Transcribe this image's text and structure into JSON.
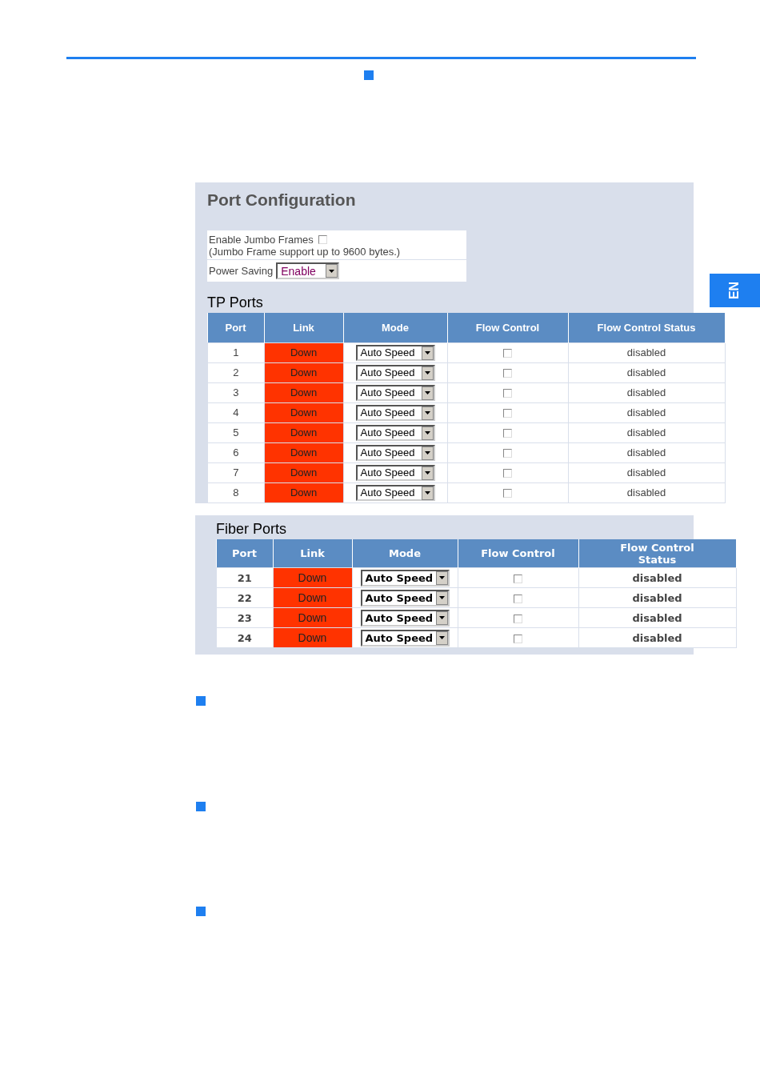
{
  "language_tab": "EN",
  "panel": {
    "title": "Port Configuration",
    "jumbo_frames": {
      "label": "Enable Jumbo Frames",
      "checked": false,
      "note": "(Jumbo Frame support up to 9600 bytes.)"
    },
    "power_saving": {
      "label": "Power Saving",
      "value": "Enable"
    }
  },
  "tp_ports": {
    "title": "TP Ports",
    "columns": [
      "Port",
      "Link",
      "Mode",
      "Flow Control",
      "Flow Control Status"
    ],
    "rows": [
      {
        "port": "1",
        "link": "Down",
        "link_up": false,
        "mode": "Auto Speed",
        "flow_control": false,
        "status": "disabled"
      },
      {
        "port": "2",
        "link": "Down",
        "link_up": false,
        "mode": "Auto Speed",
        "flow_control": false,
        "status": "disabled"
      },
      {
        "port": "3",
        "link": "Down",
        "link_up": false,
        "mode": "Auto Speed",
        "flow_control": false,
        "status": "disabled"
      },
      {
        "port": "4",
        "link": "Down",
        "link_up": false,
        "mode": "Auto Speed",
        "flow_control": false,
        "status": "disabled"
      },
      {
        "port": "5",
        "link": "Down",
        "link_up": false,
        "mode": "Auto Speed",
        "flow_control": false,
        "status": "disabled"
      },
      {
        "port": "6",
        "link": "Down",
        "link_up": false,
        "mode": "Auto Speed",
        "flow_control": false,
        "status": "disabled"
      },
      {
        "port": "7",
        "link": "Down",
        "link_up": false,
        "mode": "Auto Speed",
        "flow_control": false,
        "status": "disabled"
      },
      {
        "port": "8",
        "link": "Down",
        "link_up": false,
        "mode": "Auto Speed",
        "flow_control": false,
        "status": "disabled"
      }
    ]
  },
  "fiber_ports": {
    "title": "Fiber Ports",
    "columns": [
      "Port",
      "Link",
      "Mode",
      "Flow Control",
      "Flow Control Status"
    ],
    "rows": [
      {
        "port": "21",
        "link": "Down",
        "link_up": false,
        "mode": "Auto Speed",
        "flow_control": false,
        "status": "disabled"
      },
      {
        "port": "22",
        "link": "Down",
        "link_up": false,
        "mode": "Auto Speed",
        "flow_control": false,
        "status": "disabled"
      },
      {
        "port": "23",
        "link": "Down",
        "link_up": false,
        "mode": "Auto Speed",
        "flow_control": false,
        "status": "disabled"
      },
      {
        "port": "24",
        "link": "Down",
        "link_up": false,
        "mode": "Auto Speed",
        "flow_control": false,
        "status": "disabled"
      }
    ]
  }
}
